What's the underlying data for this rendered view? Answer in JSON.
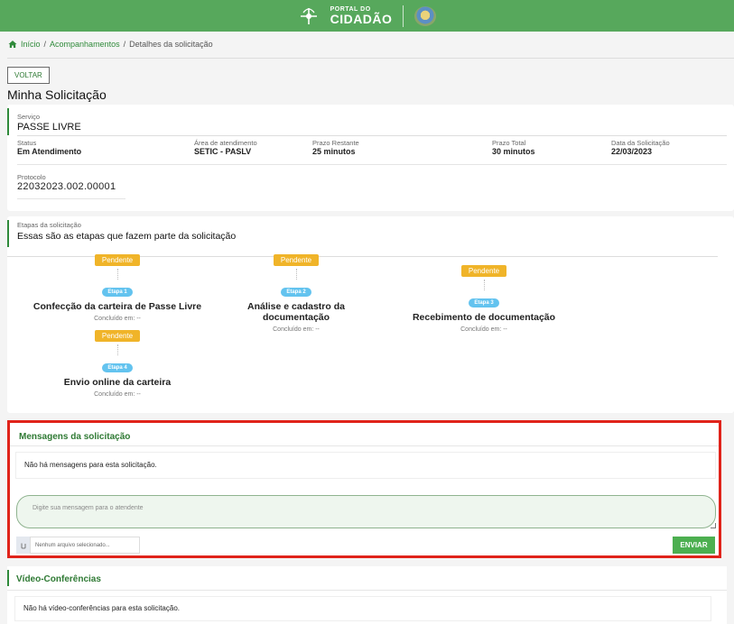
{
  "header": {
    "logo_line1": "PORTAL DO",
    "logo_line2": "CIDADÃO"
  },
  "breadcrumb": {
    "home": "Início",
    "sep1": "/",
    "item2": "Acompanhamentos",
    "sep2": "/",
    "item3": "Detalhes da solicitação"
  },
  "back_button": "VOLTAR",
  "page_title": "Minha Solicitação",
  "service": {
    "label": "Serviço",
    "value": "PASSE LIVRE",
    "status_label": "Status",
    "status_value": "Em Atendimento",
    "area_label": "Área de atendimento",
    "area_value": "SETIC - PASLV",
    "prazo_restante_label": "Prazo Restante",
    "prazo_restante_value": "25 minutos",
    "prazo_total_label": "Prazo Total",
    "prazo_total_value": "30 minutos",
    "data_label": "Data da Solicitação",
    "data_value": "22/03/2023",
    "protocolo_label": "Protocolo",
    "protocolo_value": "22032023.002.00001"
  },
  "stages": {
    "label": "Etapas da solicitação",
    "subtitle": "Essas são as etapas que fazem parte da solicitação",
    "items": [
      {
        "status": "Pendente",
        "etapa": "Etapa 1",
        "title": "Confecção da carteira de Passe Livre",
        "done": "Concluído em: --"
      },
      {
        "status": "Pendente",
        "etapa": "Etapa 2",
        "title": "Análise e cadastro da documentação",
        "done": "Concluído em: --"
      },
      {
        "status": "Pendente",
        "etapa": "Etapa 3",
        "title": "Recebimento de documentação",
        "done": "Concluído em: --"
      },
      {
        "status": "Pendente",
        "etapa": "Etapa 4",
        "title": "Envio online da carteira",
        "done": "Concluído em: --"
      }
    ]
  },
  "messages": {
    "title": "Mensagens da solicitação",
    "empty": "Não há mensagens para esta solicitação.",
    "placeholder": "Digite sua mensagem para o atendente",
    "file_none": "Nenhum arquivo selecionado...",
    "send": "ENVIAR"
  },
  "video": {
    "title": "Vídeo-Conferências",
    "empty": "Não há vídeo-conferências para esta solicitação."
  },
  "colors": {
    "brand_green": "#57a85c",
    "pending": "#f0b429",
    "etapa": "#63c3ef",
    "highlight_red": "#e0231a",
    "send_button": "#4caf50"
  }
}
